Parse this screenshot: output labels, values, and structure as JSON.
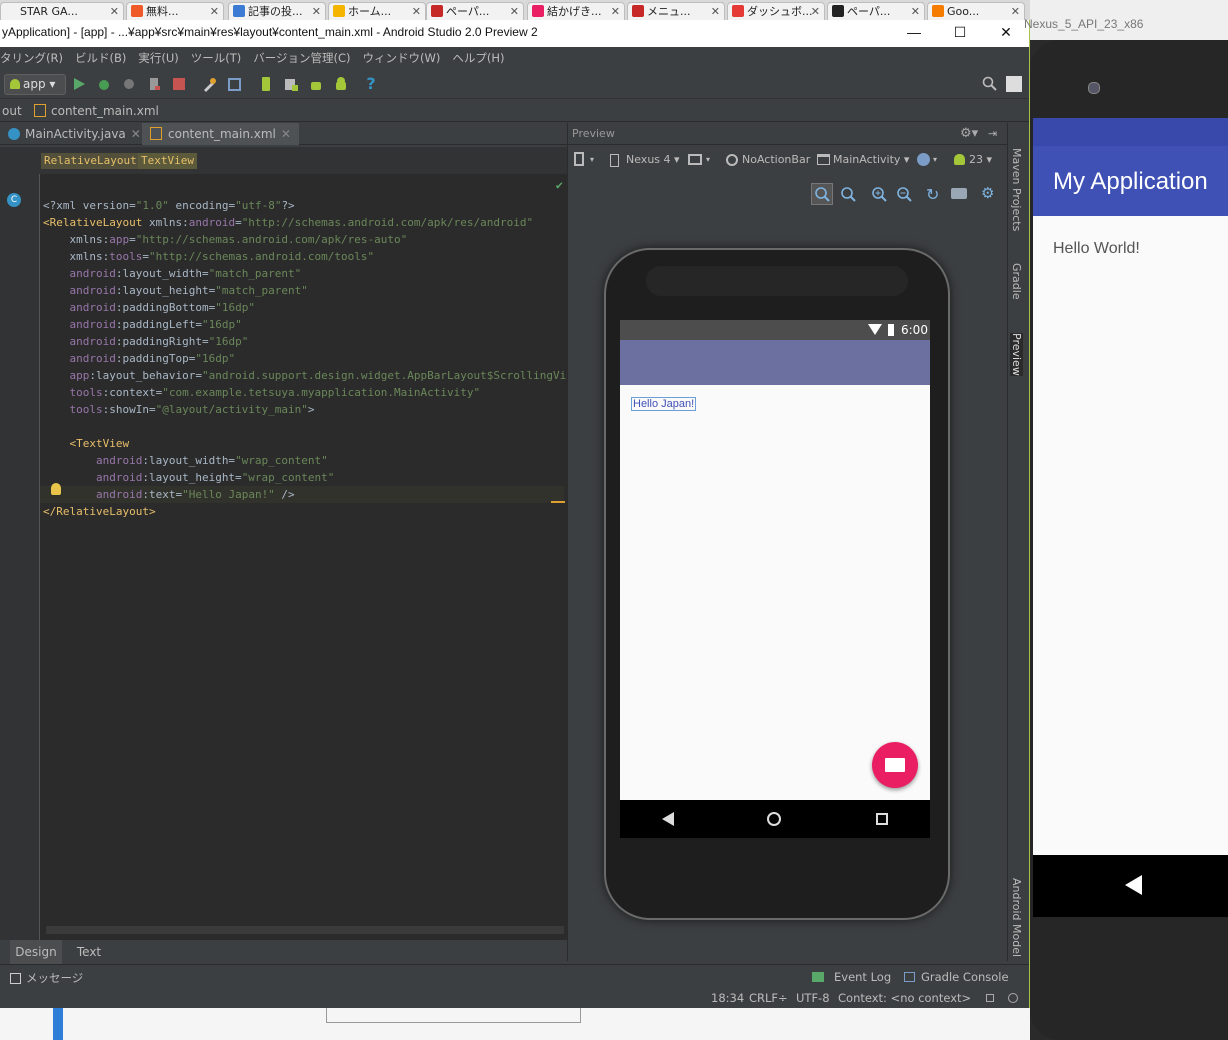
{
  "browser_tabs": [
    {
      "label": "STAR GA...",
      "color": "#f2f2f2"
    },
    {
      "label": "無料...",
      "color": "#f05a28"
    },
    {
      "label": "記事の投...",
      "color": "#3b7bd4"
    },
    {
      "label": "ホーム...",
      "color": "#f5b400"
    },
    {
      "label": "ペーパ...",
      "color": "#c62828"
    },
    {
      "label": "結かげき...",
      "color": "#e91e63"
    },
    {
      "label": "メニュ...",
      "color": "#c62828"
    },
    {
      "label": "ダッシュボ...",
      "color": "#e53935"
    },
    {
      "label": "ペーパ...",
      "color": "#222222"
    },
    {
      "label": "Goo...",
      "color": "#f57c00"
    }
  ],
  "window": {
    "title": "yApplication] - [app] - ...¥app¥src¥main¥res¥layout¥content_main.xml - Android Studio 2.0 Preview 2",
    "minimize": "—",
    "maximize": "☐",
    "close": "✕"
  },
  "menu": [
    "タリング(R)",
    "ビルド(B)",
    "実行(U)",
    "ツール(T)",
    "バージョン管理(C)",
    "ウィンドウ(W)",
    "ヘルプ(H)"
  ],
  "toolbar": {
    "run_config": "app"
  },
  "breadcrumb": {
    "parent": "out",
    "file": "content_main.xml"
  },
  "editor_tabs": [
    {
      "label": "MainActivity.java",
      "active": false
    },
    {
      "label": "content_main.xml",
      "active": true
    }
  ],
  "element_path": [
    "RelativeLayout",
    "TextView"
  ],
  "code_lines": [
    [
      [
        "plain",
        "<?xml version="
      ],
      [
        "val",
        "\"1.0\""
      ],
      [
        "plain",
        " encoding="
      ],
      [
        "val",
        "\"utf-8\""
      ],
      [
        "plain",
        "?>"
      ]
    ],
    [
      [
        "tag",
        "<RelativeLayout"
      ],
      [
        "plain",
        " xmlns:"
      ],
      [
        "ns",
        "android"
      ],
      [
        "plain",
        "="
      ],
      [
        "val",
        "\"http://schemas.android.com/apk/res/android\""
      ]
    ],
    [
      [
        "plain",
        "    xmlns:"
      ],
      [
        "ns",
        "app"
      ],
      [
        "plain",
        "="
      ],
      [
        "val",
        "\"http://schemas.android.com/apk/res-auto\""
      ]
    ],
    [
      [
        "plain",
        "    xmlns:"
      ],
      [
        "ns",
        "tools"
      ],
      [
        "plain",
        "="
      ],
      [
        "val",
        "\"http://schemas.android.com/tools\""
      ]
    ],
    [
      [
        "ns",
        "    android"
      ],
      [
        "plain",
        ":layout_width="
      ],
      [
        "val",
        "\"match_parent\""
      ]
    ],
    [
      [
        "ns",
        "    android"
      ],
      [
        "plain",
        ":layout_height="
      ],
      [
        "val",
        "\"match_parent\""
      ]
    ],
    [
      [
        "ns",
        "    android"
      ],
      [
        "plain",
        ":paddingBottom="
      ],
      [
        "val",
        "\"16dp\""
      ]
    ],
    [
      [
        "ns",
        "    android"
      ],
      [
        "plain",
        ":paddingLeft="
      ],
      [
        "val",
        "\"16dp\""
      ]
    ],
    [
      [
        "ns",
        "    android"
      ],
      [
        "plain",
        ":paddingRight="
      ],
      [
        "val",
        "\"16dp\""
      ]
    ],
    [
      [
        "ns",
        "    android"
      ],
      [
        "plain",
        ":paddingTop="
      ],
      [
        "val",
        "\"16dp\""
      ]
    ],
    [
      [
        "ns",
        "    app"
      ],
      [
        "plain",
        ":layout_behavior="
      ],
      [
        "val",
        "\"android.support.design.widget.AppBarLayout$ScrollingVie...\""
      ]
    ],
    [
      [
        "ns",
        "    tools"
      ],
      [
        "plain",
        ":context="
      ],
      [
        "val",
        "\"com.example.tetsuya.myapplication.MainActivity\""
      ]
    ],
    [
      [
        "ns",
        "    tools"
      ],
      [
        "plain",
        ":showIn="
      ],
      [
        "val",
        "\"@layout/activity_main\""
      ],
      [
        "plain",
        ">"
      ]
    ],
    [
      [
        "plain",
        ""
      ]
    ],
    [
      [
        "tag",
        "    <TextView"
      ]
    ],
    [
      [
        "ns",
        "        android"
      ],
      [
        "plain",
        ":layout_width="
      ],
      [
        "val",
        "\"wrap_content\""
      ]
    ],
    [
      [
        "ns",
        "        android"
      ],
      [
        "plain",
        ":layout_height="
      ],
      [
        "val",
        "\"wrap_content\""
      ]
    ],
    [
      [
        "ns",
        "        android"
      ],
      [
        "plain",
        ":text="
      ],
      [
        "val",
        "\"Hello Japan!\""
      ],
      [
        "plain",
        " />"
      ]
    ],
    [
      [
        "tag",
        "</RelativeLayout>"
      ]
    ]
  ],
  "design_tabs": [
    "Design",
    "Text"
  ],
  "preview": {
    "header": "Preview",
    "device": "Nexus 4",
    "theme": "NoActionBar",
    "activity": "MainActivity",
    "api": "23",
    "clock": "6:00",
    "text": "Hello Japan!"
  },
  "side_tools": [
    "Maven Projects",
    "Gradle",
    "Preview",
    "Android Model"
  ],
  "status": {
    "messages": "メッセージ",
    "event_log": "Event Log",
    "gradle_console": "Gradle Console",
    "position": "18:34",
    "line_sep": "CRLF÷",
    "encoding": "UTF-8",
    "context": "Context: <no context>"
  },
  "emulator": {
    "title": "Nexus_5_API_23_x86",
    "app_title": "My Application",
    "hello": "Hello World!",
    "accent": "#3f51b5"
  },
  "colors": {
    "fab": "#e91e63",
    "appbar_preview": "#6b70a1",
    "editor_bg": "#2b2b2b"
  }
}
